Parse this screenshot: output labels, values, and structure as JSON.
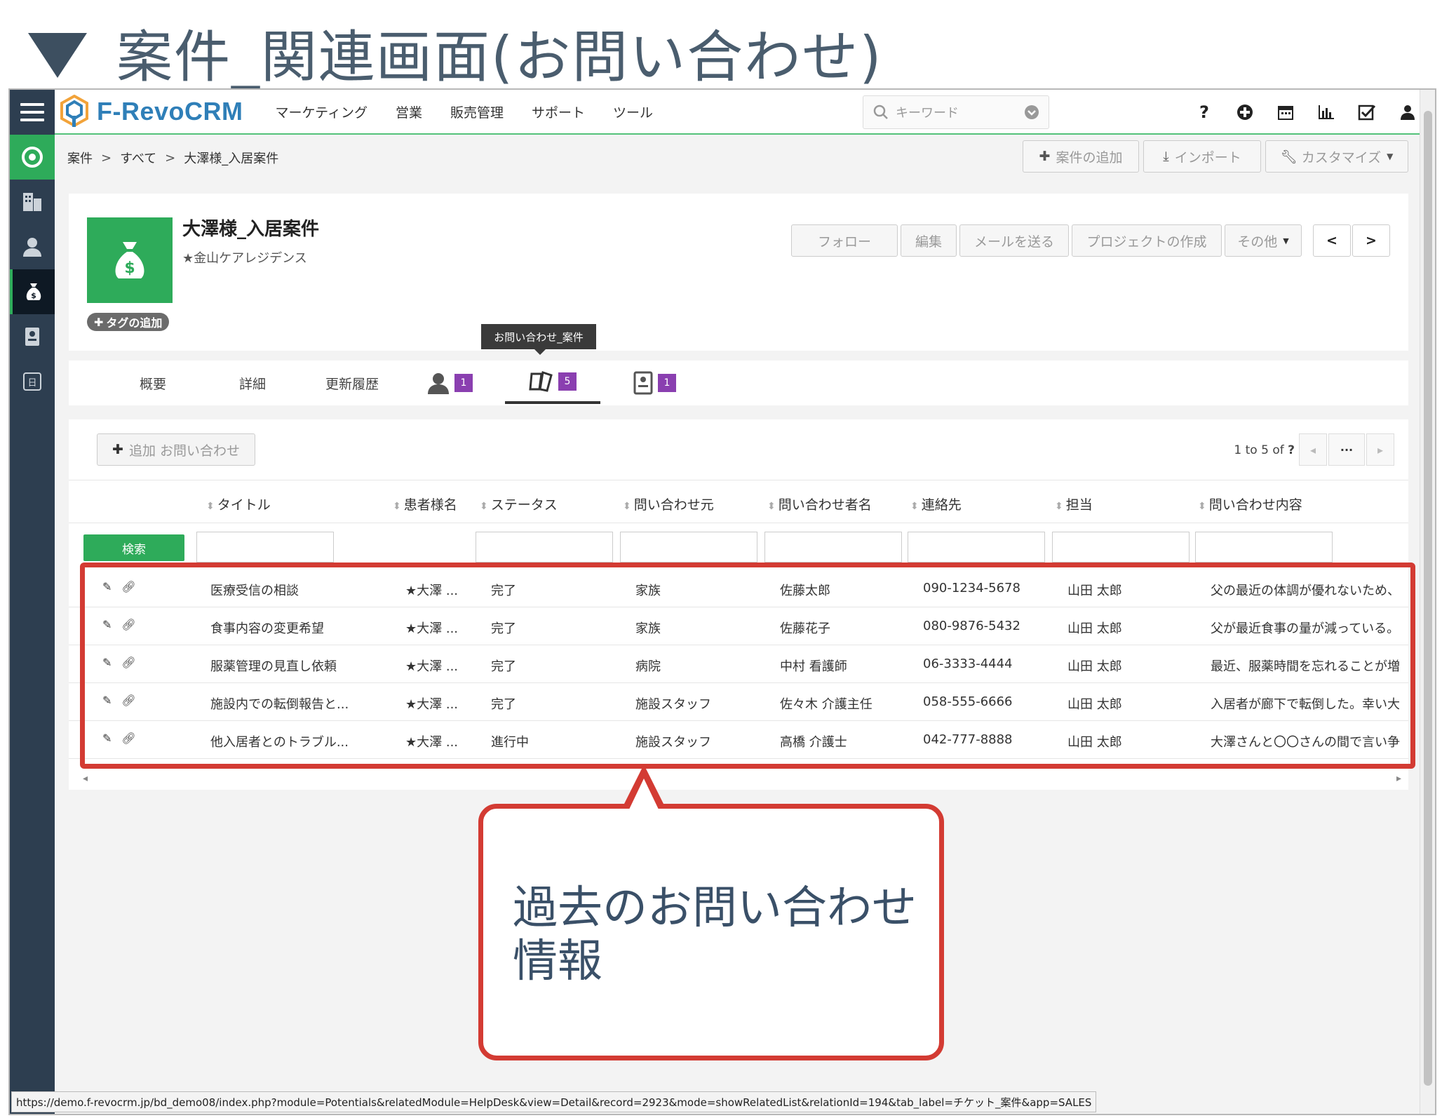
{
  "slide": {
    "heading": "案件_関連画面(お問い合わせ)"
  },
  "app": {
    "brand": "F-RevoCRM",
    "nav": [
      "マーケティング",
      "営業",
      "販売管理",
      "サポート",
      "ツール"
    ],
    "search_placeholder": "キーワード"
  },
  "breadcrumb": [
    "案件",
    "すべて",
    "大澤様_入居案件"
  ],
  "header_buttons": {
    "add": "案件の追加",
    "import": "インポート",
    "customize": "カスタマイズ"
  },
  "record": {
    "name": "大澤様_入居案件",
    "related_account": "★金山ケアレジデンス",
    "add_tag": "タグの追加",
    "actions": [
      "フォロー",
      "編集",
      "メールを送る",
      "プロジェクトの作成",
      "その他"
    ]
  },
  "tooltip": "お問い合わせ_案件",
  "tabs": [
    {
      "label": "概要"
    },
    {
      "label": "詳細"
    },
    {
      "label": "更新履歴"
    },
    {
      "icon": "person-icon",
      "count": "1"
    },
    {
      "icon": "ticket-icon",
      "count": "5"
    },
    {
      "icon": "contact-card-icon",
      "count": "1"
    }
  ],
  "related": {
    "add_label": "追加 お問い合わせ",
    "pager_prefix": "1 to 5  of",
    "pager_total": "?",
    "search_label": "検索",
    "columns": [
      "タイトル",
      "患者様名",
      "ステータス",
      "問い合わせ元",
      "問い合わせ者名",
      "連絡先",
      "担当",
      "問い合わせ内容"
    ],
    "rows": [
      [
        "医療受信の相談",
        "★大澤 ...",
        "完了",
        "家族",
        "佐藤太郎",
        "090-1234-5678",
        "山田 太郎",
        "父の最近の体調が優れないため、"
      ],
      [
        "食事内容の変更希望",
        "★大澤 ...",
        "完了",
        "家族",
        "佐藤花子",
        "080-9876-5432",
        "山田 太郎",
        "父が最近食事の量が減っている。"
      ],
      [
        "服薬管理の見直し依頼",
        "★大澤 ...",
        "完了",
        "病院",
        "中村 看護師",
        "06-3333-4444",
        "山田 太郎",
        "最近、服薬時間を忘れることが増"
      ],
      [
        "施設内での転倒報告と...",
        "★大澤 ...",
        "完了",
        "施設スタッフ",
        "佐々木 介護主任",
        "058-555-6666",
        "山田 太郎",
        "入居者が廊下で転倒した。幸い大"
      ],
      [
        "他入居者とのトラブル...",
        "★大澤 ...",
        "進行中",
        "施設スタッフ",
        "高橋 介護士",
        "042-777-8888",
        "山田 太郎",
        "大澤さんと〇〇さんの間で言い争"
      ]
    ]
  },
  "callout": {
    "line1": "過去のお問い合わせ",
    "line2": "情報"
  },
  "status_url": "https://demo.f-revocrm.jp/bd_demo08/index.php?module=Potentials&relatedModule=HelpDesk&view=Detail&record=2923&mode=showRelatedList&relationId=194&tab_label=チケット_案件&app=SALES",
  "colors": {
    "brand_green": "#2eab5a",
    "sidebar": "#2d3e50",
    "callout_red": "#d33b33",
    "badge_purple": "#8a3fb0"
  }
}
